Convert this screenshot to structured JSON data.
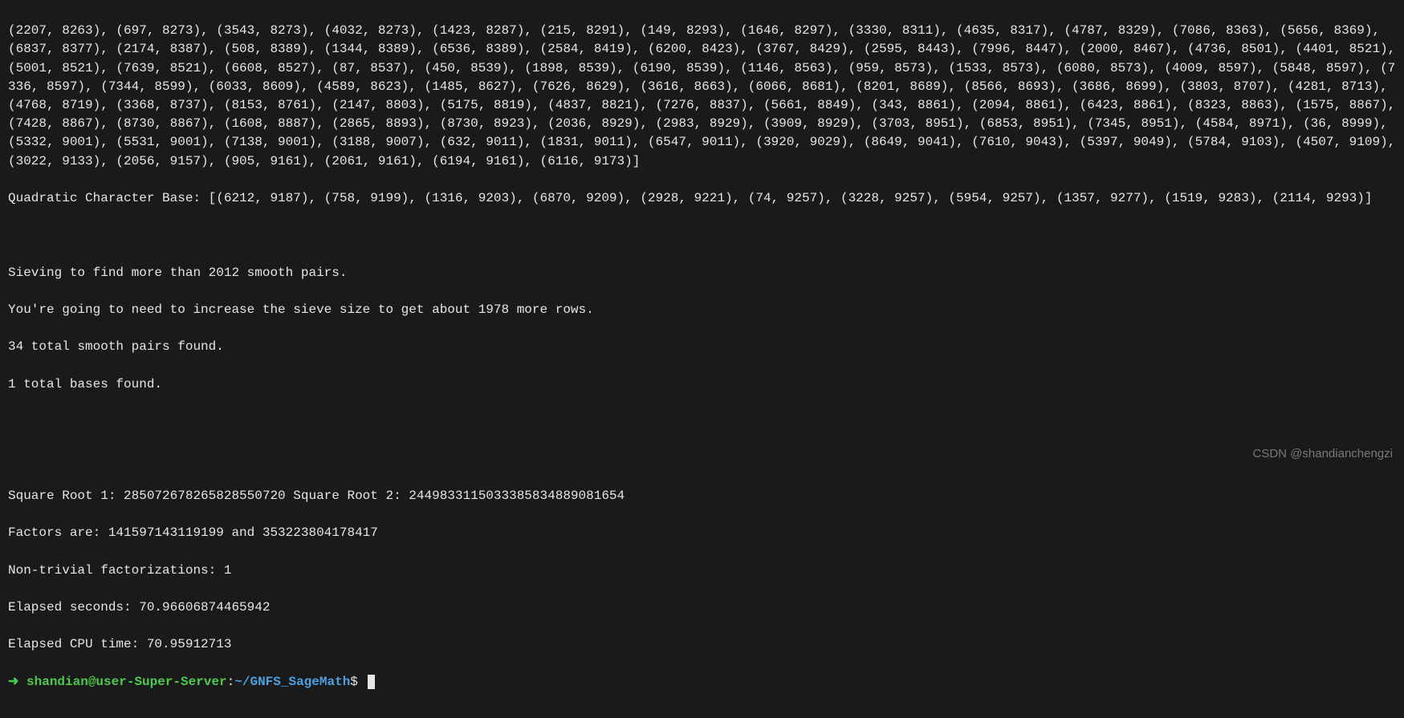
{
  "terminal": {
    "pairs_block": "(2207, 8263), (697, 8273), (3543, 8273), (4032, 8273), (1423, 8287), (215, 8291), (149, 8293), (1646, 8297), (3330, 8311), (4635, 8317), (4787, 8329), (7086, 8363), (5656, 8369), (6837, 8377), (2174, 8387), (508, 8389), (1344, 8389), (6536, 8389), (2584, 8419), (6200, 8423), (3767, 8429), (2595, 8443), (7996, 8447), (2000, 8467), (4736, 8501), (4401, 8521), (5001, 8521), (7639, 8521), (6608, 8527), (87, 8537), (450, 8539), (1898, 8539), (6190, 8539), (1146, 8563), (959, 8573), (1533, 8573), (6080, 8573), (4009, 8597), (5848, 8597), (7336, 8597), (7344, 8599), (6033, 8609), (4589, 8623), (1485, 8627), (7626, 8629), (3616, 8663), (6066, 8681), (8201, 8689), (8566, 8693), (3686, 8699), (3803, 8707), (4281, 8713), (4768, 8719), (3368, 8737), (8153, 8761), (2147, 8803), (5175, 8819), (4837, 8821), (7276, 8837), (5661, 8849), (343, 8861), (2094, 8861), (6423, 8861), (8323, 8863), (1575, 8867), (7428, 8867), (8730, 8867), (1608, 8887), (2865, 8893), (8730, 8923), (2036, 8929), (2983, 8929), (3909, 8929), (3703, 8951), (6853, 8951), (7345, 8951), (4584, 8971), (36, 8999), (5332, 9001), (5531, 9001), (7138, 9001), (3188, 9007), (632, 9011), (1831, 9011), (6547, 9011), (3920, 9029), (8649, 9041), (7610, 9043), (5397, 9049), (5784, 9103), (4507, 9109), (3022, 9133), (2056, 9157), (905, 9161), (2061, 9161), (6194, 9161), (6116, 9173)]",
    "qcb_label": "Quadratic Character Base: ",
    "qcb_value": "[(6212, 9187), (758, 9199), (1316, 9203), (6870, 9209), (2928, 9221), (74, 9257), (3228, 9257), (5954, 9257), (1357, 9277), (1519, 9283), (2114, 9293)]",
    "sieving_line": "Sieving to find more than 2012 smooth pairs.",
    "sieving_target": 2012,
    "increase_line": "You're going to need to increase the sieve size to get about 1978 more rows.",
    "rows_needed": 1978,
    "smooth_pairs_line": "34 total smooth pairs found.",
    "smooth_pairs_count": 34,
    "bases_line": "1 total bases found.",
    "bases_count": 1,
    "sqrt_line": "Square Root 1: 28507267826582​8550720 Square Root 2: 244983311503338583488​9081654",
    "sqrt_line_plain": "Square Root 1: 285072678265828550720 Square Root 2: 2449833115033385834889081654",
    "sqrt1": "285072678265828550720",
    "sqrt2": "2449833115033385834889081654",
    "factors_line": "Factors are: 141597143119199 and 353223804178417",
    "factor1": "141597143119199",
    "factor2": "353223804178417",
    "nontrivial_line": "Non-trivial factorizations: 1",
    "nontrivial_count": 1,
    "elapsed_seconds_line": "Elapsed seconds: 70.96606874465942",
    "elapsed_seconds": 70.96606874465942,
    "elapsed_cpu_line": "Elapsed CPU time: 70.95912713",
    "elapsed_cpu": 70.95912713,
    "prompt": {
      "arrow": "➜ ",
      "user_host": "shandian@user-Super-Server",
      "colon": ":",
      "path": "~/GNFS_SageMath",
      "dollar": "$"
    }
  },
  "watermark": "CSDN @shandianchengzi"
}
